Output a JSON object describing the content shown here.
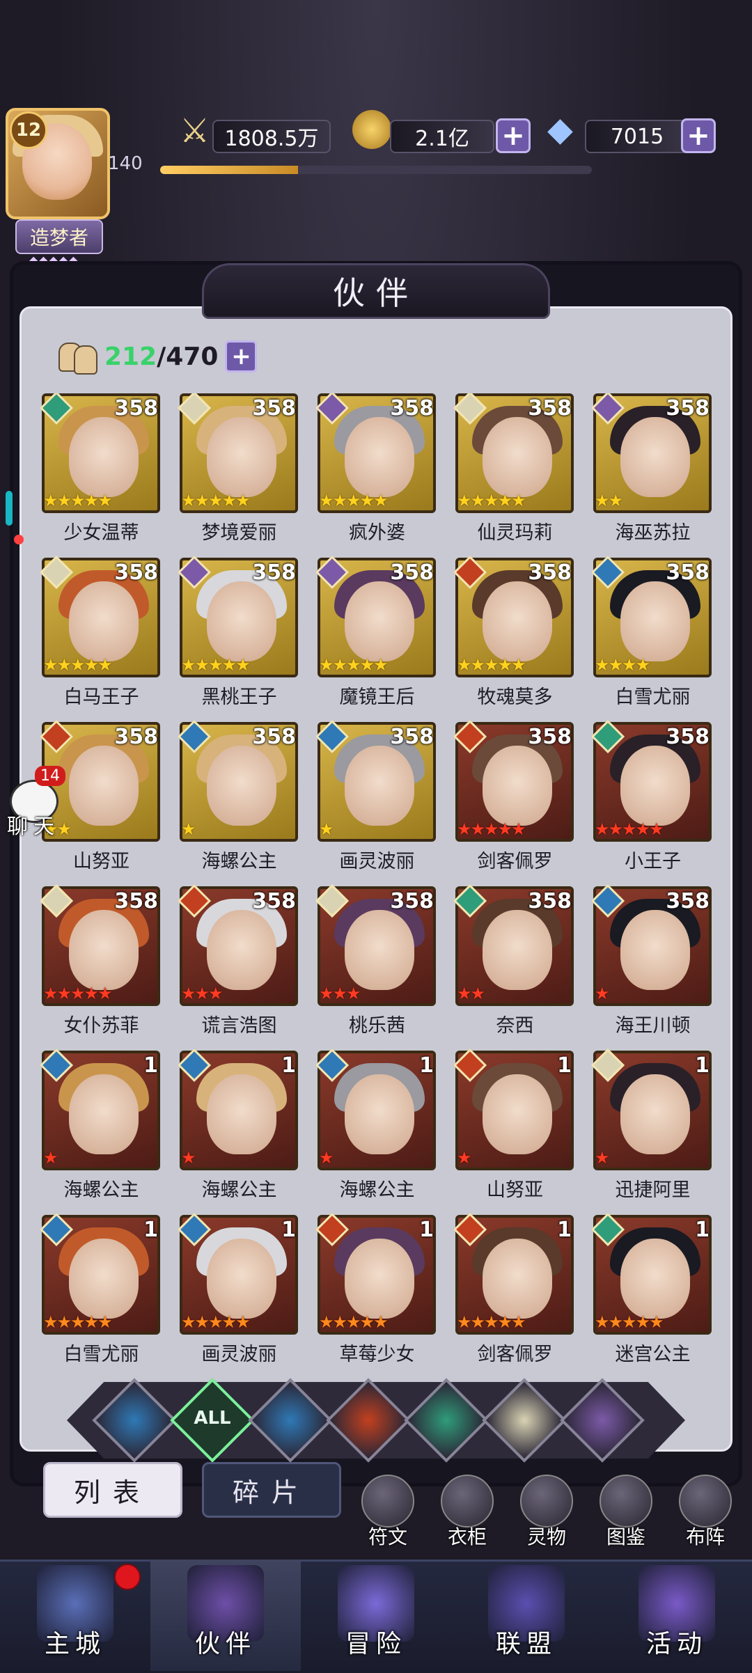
{
  "player": {
    "level": "12",
    "exp": "140",
    "exp_progress": 0.32,
    "title": "造梦者"
  },
  "resources": {
    "power": "1808.5万",
    "gold": "2.1亿",
    "gems": "7015"
  },
  "panel": {
    "title": "伙伴",
    "owned": "212",
    "capacity": "/470"
  },
  "companions": [
    {
      "name": "少女温蒂",
      "level": "358",
      "stars": 5,
      "star_color": "y",
      "element": "wind",
      "frame": "gold"
    },
    {
      "name": "梦境爱丽",
      "level": "358",
      "stars": 5,
      "star_color": "y",
      "element": "light",
      "frame": "gold"
    },
    {
      "name": "疯外婆",
      "level": "358",
      "stars": 5,
      "star_color": "y",
      "element": "dark",
      "frame": "gold"
    },
    {
      "name": "仙灵玛莉",
      "level": "358",
      "stars": 5,
      "star_color": "y",
      "element": "light",
      "frame": "gold"
    },
    {
      "name": "海巫苏拉",
      "level": "358",
      "stars": 2,
      "star_color": "y",
      "element": "dark",
      "frame": "gold"
    },
    {
      "name": "白马王子",
      "level": "358",
      "stars": 5,
      "star_color": "y",
      "element": "light",
      "frame": "gold"
    },
    {
      "name": "黑桃王子",
      "level": "358",
      "stars": 5,
      "star_color": "y",
      "element": "dark",
      "frame": "gold"
    },
    {
      "name": "魔镜王后",
      "level": "358",
      "stars": 5,
      "star_color": "y",
      "element": "dark",
      "frame": "gold"
    },
    {
      "name": "牧魂莫多",
      "level": "358",
      "stars": 5,
      "star_color": "y",
      "element": "fire",
      "frame": "gold"
    },
    {
      "name": "白雪尤丽",
      "level": "358",
      "stars": 4,
      "star_color": "y",
      "element": "water",
      "frame": "gold"
    },
    {
      "name": "山努亚",
      "level": "358",
      "stars": 2,
      "star_color": "y",
      "element": "fire",
      "frame": "gold"
    },
    {
      "name": "海螺公主",
      "level": "358",
      "stars": 1,
      "star_color": "y",
      "element": "water",
      "frame": "gold"
    },
    {
      "name": "画灵波丽",
      "level": "358",
      "stars": 1,
      "star_color": "y",
      "element": "water",
      "frame": "gold"
    },
    {
      "name": "剑客佩罗",
      "level": "358",
      "stars": 5,
      "star_color": "r",
      "element": "fire",
      "frame": "red"
    },
    {
      "name": "小王子",
      "level": "358",
      "stars": 5,
      "star_color": "r",
      "element": "wind",
      "frame": "red"
    },
    {
      "name": "女仆苏菲",
      "level": "358",
      "stars": 5,
      "star_color": "r",
      "element": "light",
      "frame": "red"
    },
    {
      "name": "谎言浩图",
      "level": "358",
      "stars": 3,
      "star_color": "r",
      "element": "fire",
      "frame": "red"
    },
    {
      "name": "桃乐茜",
      "level": "358",
      "stars": 3,
      "star_color": "r",
      "element": "light",
      "frame": "red"
    },
    {
      "name": "奈西",
      "level": "358",
      "stars": 2,
      "star_color": "r",
      "element": "wind",
      "frame": "red"
    },
    {
      "name": "海王川顿",
      "level": "358",
      "stars": 1,
      "star_color": "r",
      "element": "water",
      "frame": "red"
    },
    {
      "name": "海螺公主",
      "level": "1",
      "stars": 1,
      "star_color": "r",
      "element": "water",
      "frame": "red"
    },
    {
      "name": "海螺公主",
      "level": "1",
      "stars": 1,
      "star_color": "r",
      "element": "water",
      "frame": "red"
    },
    {
      "name": "海螺公主",
      "level": "1",
      "stars": 1,
      "star_color": "r",
      "element": "water",
      "frame": "red"
    },
    {
      "name": "山努亚",
      "level": "1",
      "stars": 1,
      "star_color": "r",
      "element": "fire",
      "frame": "red"
    },
    {
      "name": "迅捷阿里",
      "level": "1",
      "stars": 1,
      "star_color": "r",
      "element": "light",
      "frame": "red"
    },
    {
      "name": "白雪尤丽",
      "level": "1",
      "stars": 5,
      "star_color": "o",
      "element": "water",
      "frame": "red"
    },
    {
      "name": "画灵波丽",
      "level": "1",
      "stars": 5,
      "star_color": "o",
      "element": "water",
      "frame": "red"
    },
    {
      "name": "草莓少女",
      "level": "1",
      "stars": 5,
      "star_color": "o",
      "element": "fire",
      "frame": "red"
    },
    {
      "name": "剑客佩罗",
      "level": "1",
      "stars": 5,
      "star_color": "o",
      "element": "fire",
      "frame": "red"
    },
    {
      "name": "迷宫公主",
      "level": "1",
      "stars": 5,
      "star_color": "o",
      "element": "wind",
      "frame": "red"
    }
  ],
  "filters": {
    "all_label": "ALL",
    "icons": [
      "water-element-icon",
      "all",
      "water-drop-icon",
      "fire-element-icon",
      "wind-element-icon",
      "light-element-icon",
      "dark-element-icon"
    ]
  },
  "sub_tabs": {
    "list": "列表",
    "fragments": "碎片"
  },
  "tools": [
    "符文",
    "衣柜",
    "灵物",
    "图鉴",
    "布阵"
  ],
  "nav": [
    "主城",
    "伙伴",
    "冒险",
    "联盟",
    "活动"
  ],
  "chat": {
    "badge": "14",
    "label": "聊天"
  },
  "colors": {
    "wind": "#2f9c7a",
    "light": "#d9d3b4",
    "dark": "#7c5aa8",
    "fire": "#c2401f",
    "water": "#2f79b6"
  }
}
